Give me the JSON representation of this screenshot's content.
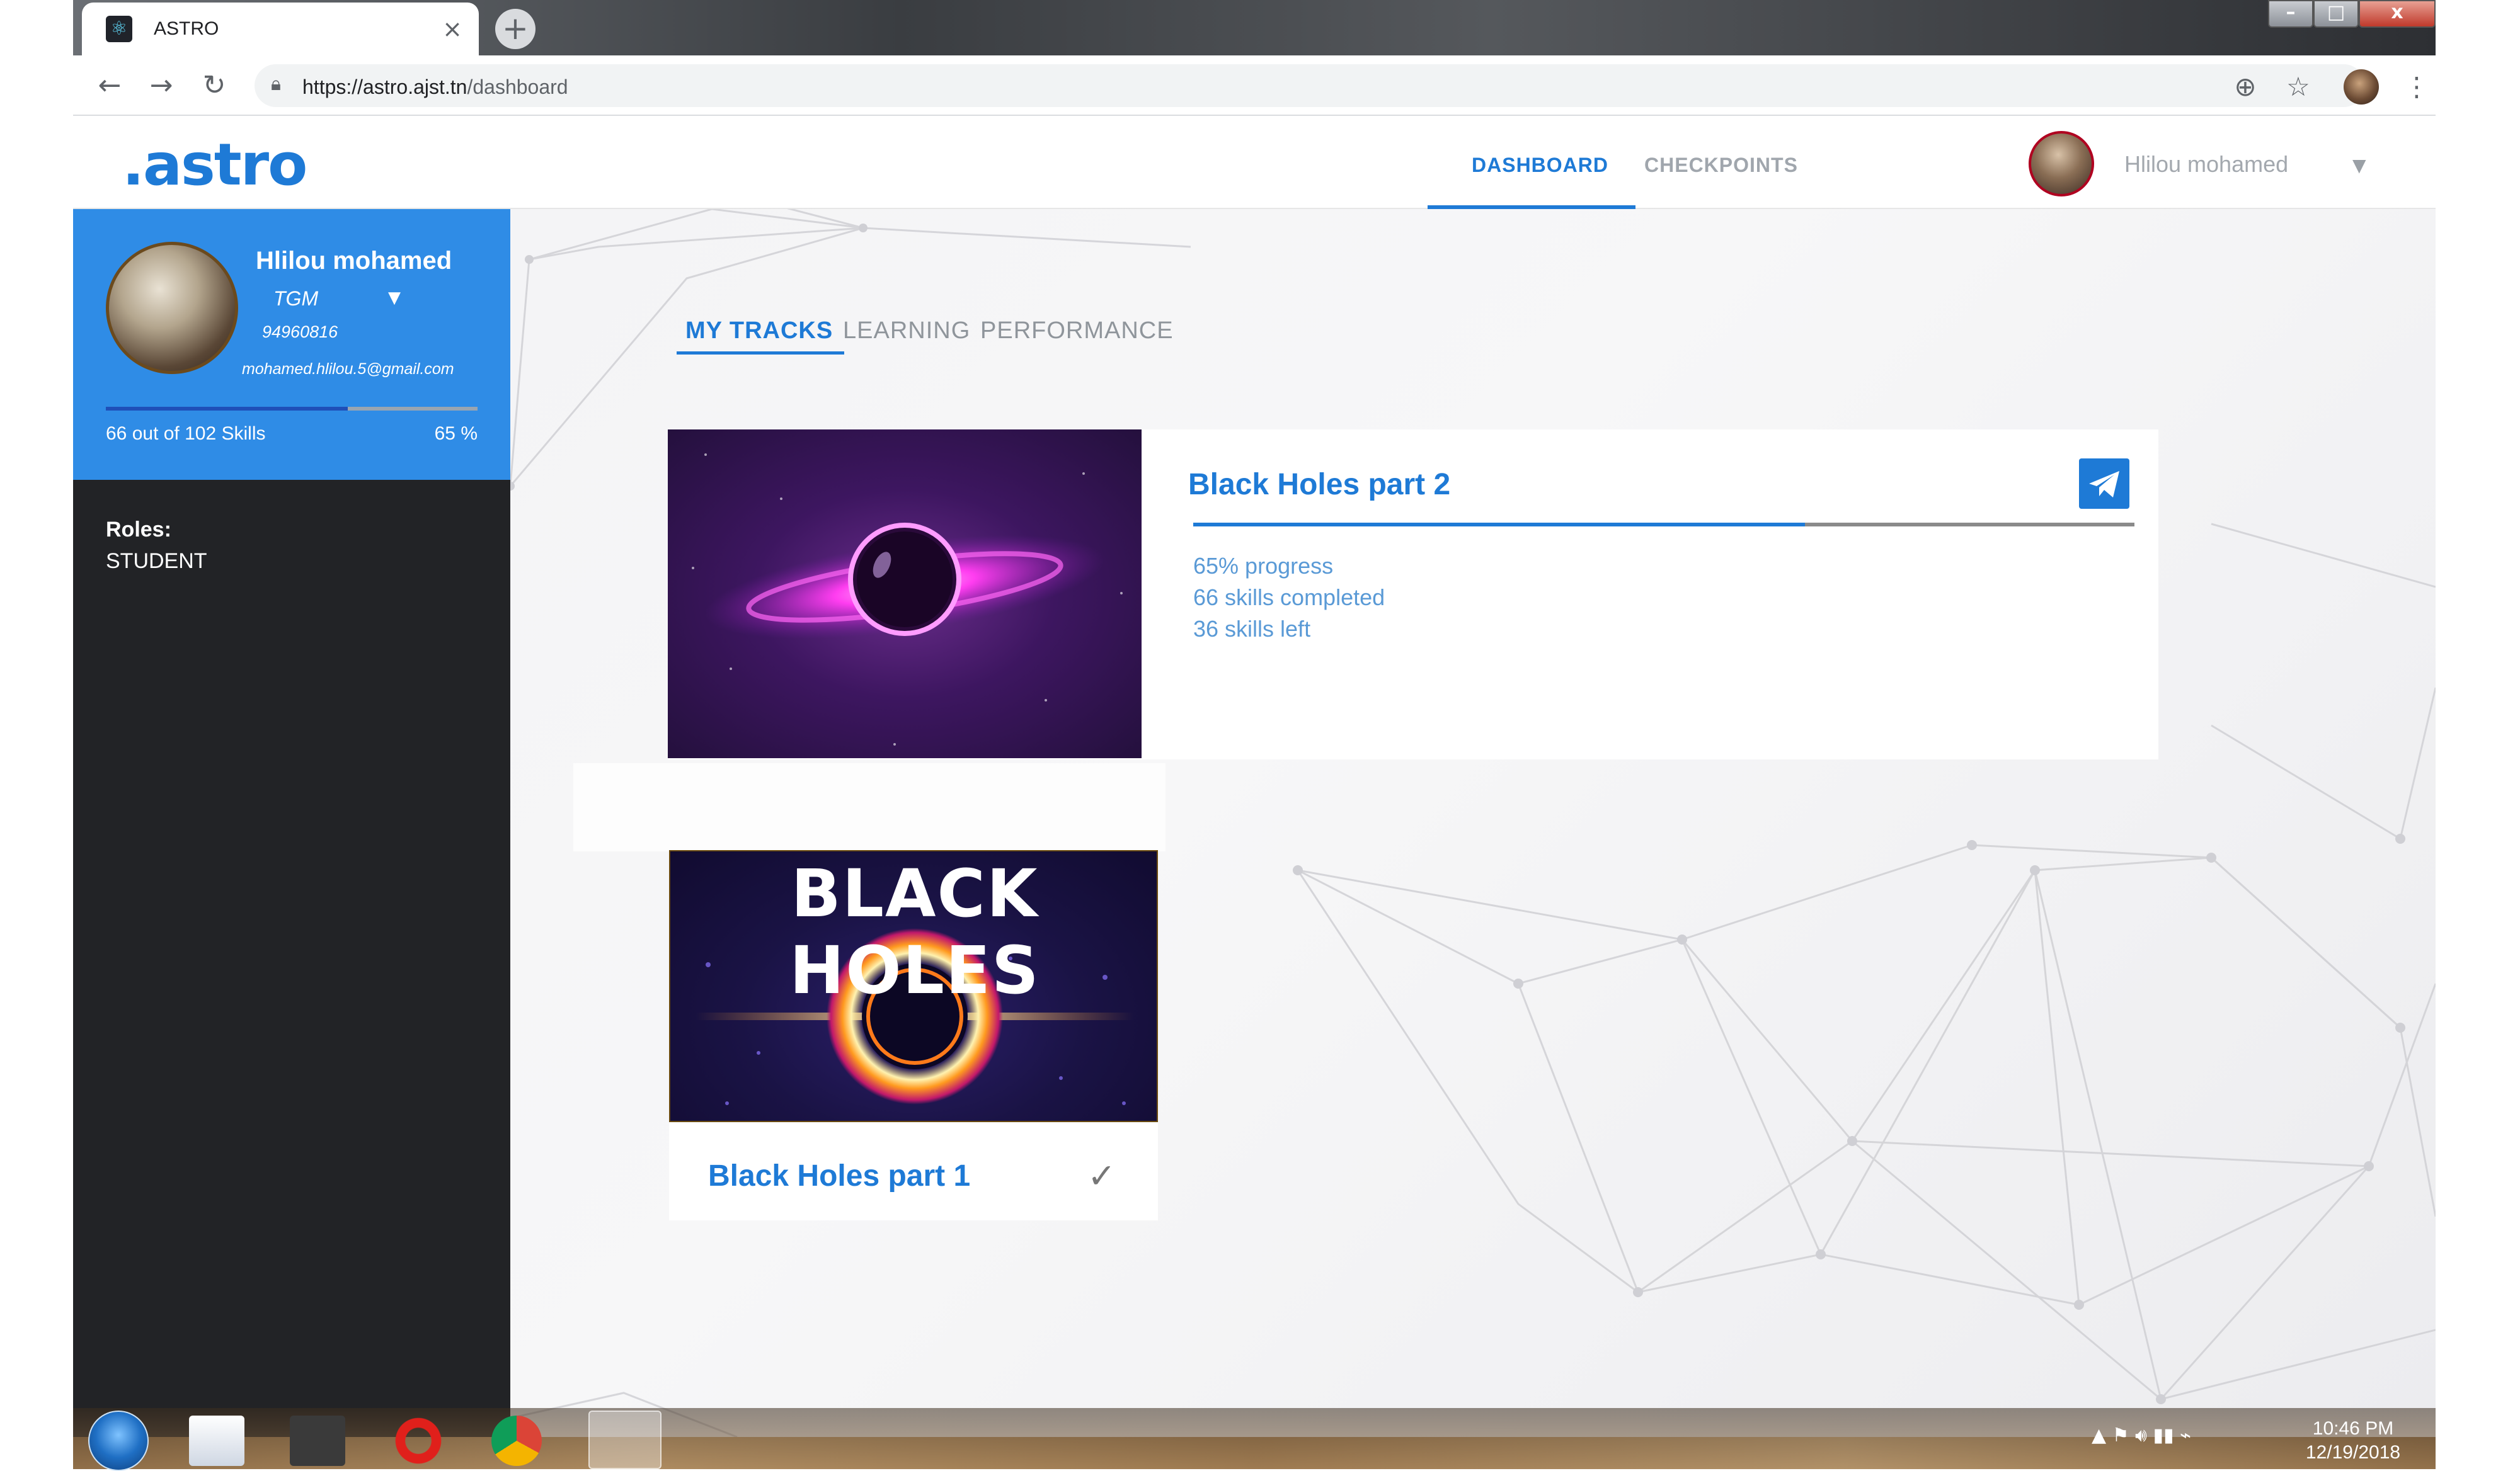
{
  "browser": {
    "tab_title": "ASTRO",
    "tab_close": "×",
    "new_tab": "+",
    "url_host": "https://astro.ajst.tn",
    "url_path": "/dashboard",
    "window_buttons": {
      "minimize": "–",
      "maximize": "□",
      "close": "x"
    }
  },
  "header": {
    "logo": ".astro",
    "nav": {
      "dashboard": "DASHBOARD",
      "checkpoints": "CHECKPOINTS"
    },
    "username": "Hlilou mohamed"
  },
  "sidebar": {
    "name": "Hlilou mohamed",
    "group": "TGM",
    "phone": "94960816",
    "email": "mohamed.hlilou.5@gmail.com",
    "skills_text": "66 out of 102 Skills",
    "percent_text": "65 %",
    "progress": 0.65,
    "roles_label": "Roles:",
    "roles_value": "STUDENT"
  },
  "main": {
    "tabs": {
      "my_tracks": "MY TRACKS",
      "learning": "LEARNING",
      "performance": "PERFORMANCE"
    },
    "tracks": [
      {
        "title": "Black Holes part 2",
        "progress": 0.65,
        "progress_text": "65% progress",
        "completed_text": "66 skills completed",
        "left_text": "36 skills left"
      },
      {
        "title": "Black Holes part 1",
        "banner": "BLACK HOLES",
        "check": "✓"
      }
    ]
  },
  "taskbar": {
    "time": "10:46 PM",
    "date": "12/19/2018"
  },
  "colors": {
    "accent": "#1e7ad6",
    "sidebar_card": "#2f8ce6",
    "sidebar_bg": "#222326"
  }
}
